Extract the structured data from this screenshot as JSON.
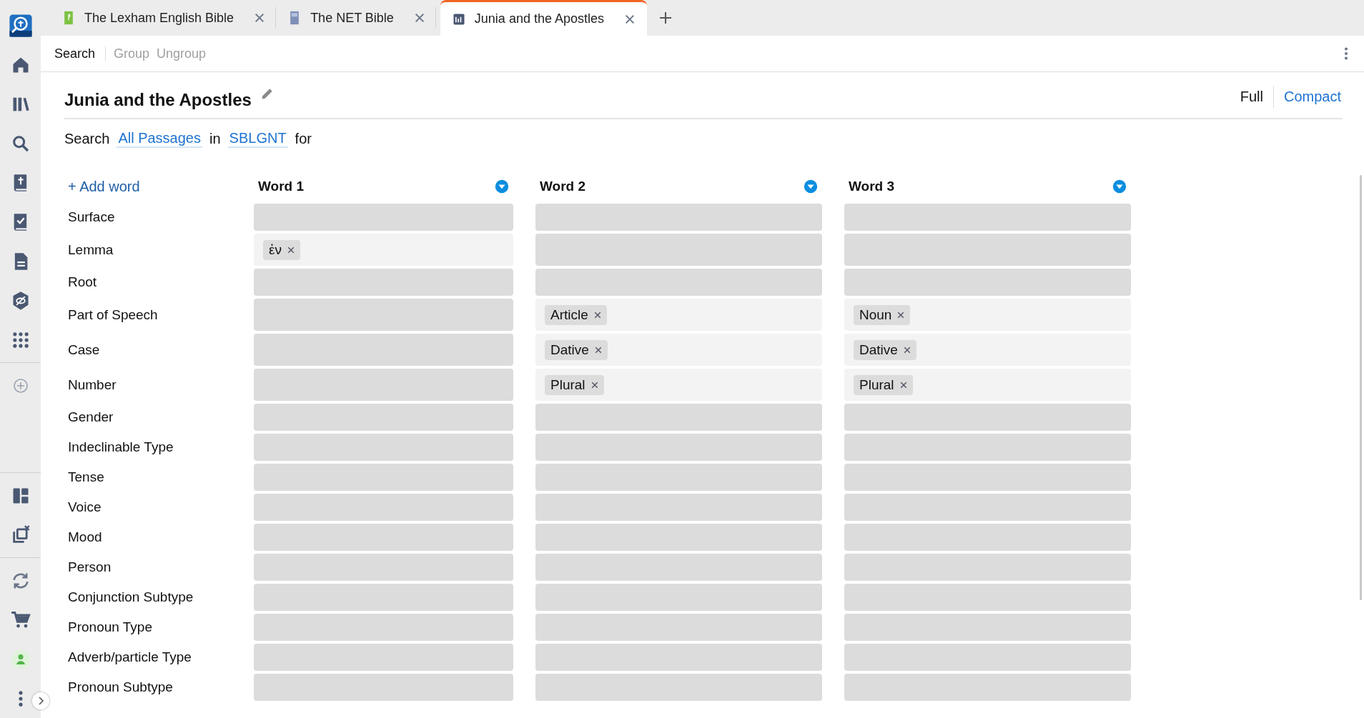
{
  "tabs": [
    {
      "label": "The Lexham English Bible",
      "selected": false,
      "kind": "book"
    },
    {
      "label": "The NET Bible",
      "selected": false,
      "kind": "book"
    },
    {
      "label": "Junia and the Apostles",
      "selected": true,
      "kind": "search"
    }
  ],
  "toolbar": [
    {
      "label": "Search",
      "disabled": false
    },
    {
      "label": "Group",
      "disabled": true
    },
    {
      "label": "Ungroup",
      "disabled": true
    }
  ],
  "title": "Junia and the Apostles",
  "view_modes": [
    {
      "label": "Full",
      "selected": true
    },
    {
      "label": "Compact",
      "selected": false
    }
  ],
  "search_line": {
    "prefix": "Search",
    "scope": "All Passages",
    "in": "in",
    "resource": "SBLGNT",
    "suffix": "for"
  },
  "add_word": "+ Add word",
  "columns": [
    "Word 1",
    "Word 2",
    "Word 3"
  ],
  "rows": [
    {
      "label": "Surface"
    },
    {
      "label": "Lemma",
      "word_1": [
        "ἐν"
      ]
    },
    {
      "label": "Root"
    },
    {
      "label": "Part of Speech",
      "word_2": [
        "Article"
      ],
      "word_3": [
        "Noun"
      ]
    },
    {
      "label": "Case",
      "word_2": [
        "Dative"
      ],
      "word_3": [
        "Dative"
      ]
    },
    {
      "label": "Number",
      "word_2": [
        "Plural"
      ],
      "word_3": [
        "Plural"
      ]
    },
    {
      "label": "Gender"
    },
    {
      "label": "Indeclinable Type"
    },
    {
      "label": "Tense"
    },
    {
      "label": "Voice"
    },
    {
      "label": "Mood"
    },
    {
      "label": "Person"
    },
    {
      "label": "Conjunction Subtype"
    },
    {
      "label": "Pronoun Type"
    },
    {
      "label": "Adverb/particle Type"
    },
    {
      "label": "Pronoun Subtype"
    }
  ]
}
